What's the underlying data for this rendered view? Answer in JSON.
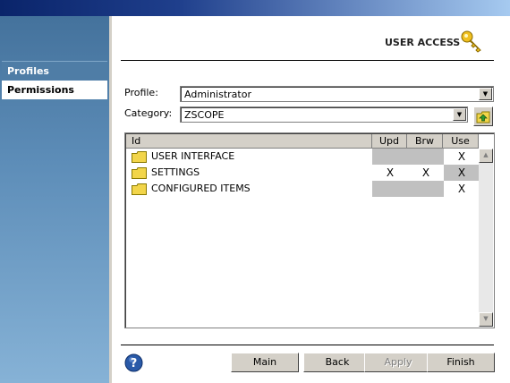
{
  "sidebar": {
    "items": [
      {
        "label": "Profiles"
      },
      {
        "label": "Permissions"
      }
    ]
  },
  "header": {
    "title": "USER ACCESS"
  },
  "form": {
    "profile_label": "Profile:",
    "profile_value": "Administrator",
    "category_label": "Category:",
    "category_value": "ZSCOPE"
  },
  "grid": {
    "columns": [
      "Id",
      "Upd",
      "Brw",
      "Use"
    ],
    "rows": [
      {
        "id": "USER INTERFACE",
        "upd": "",
        "brw": "",
        "use": "X"
      },
      {
        "id": "SETTINGS",
        "upd": "X",
        "brw": "X",
        "use": "X"
      },
      {
        "id": "CONFIGURED ITEMS",
        "upd": "",
        "brw": "",
        "use": "X"
      }
    ]
  },
  "footer": {
    "main_label": "Main",
    "back_label": "Back",
    "apply_label": "Apply",
    "finish_label": "Finish"
  }
}
